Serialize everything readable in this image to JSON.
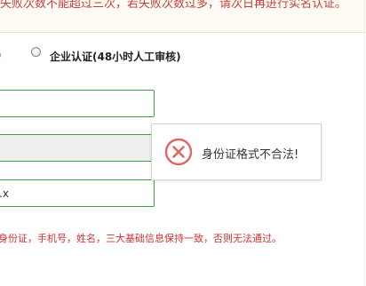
{
  "notice": {
    "text": "失败次数不能超过三次，若失败次数过多，请次日再进行实名认证。"
  },
  "auth_options": {
    "personal_suffix": ")",
    "enterprise_label": "企业认证(48小时人工审核)"
  },
  "fields": {
    "field1_value": "",
    "field2_value": "",
    "field3_value": ".x"
  },
  "tooltip": {
    "message": "身份证格式不合法!",
    "icon": "error-x-circle-icon",
    "icon_color": "#e06666"
  },
  "hint": {
    "text": "身份证，手机号，姓名，三大基础信息保持一致，否则无法通过。"
  },
  "colors": {
    "field_border": "#3aa33a",
    "error_text": "#d23232"
  }
}
